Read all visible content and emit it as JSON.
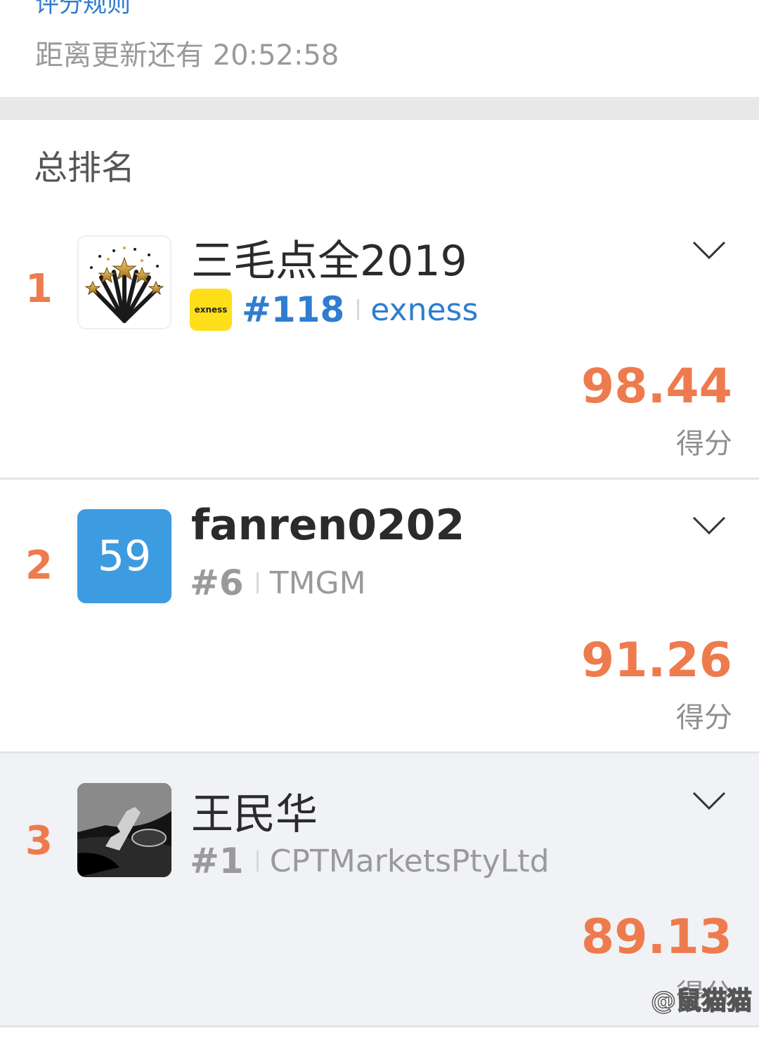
{
  "header": {
    "rules_link": "评分规则",
    "countdown": "距离更新还有 20:52:58"
  },
  "section_title": "总排名",
  "ranking": [
    {
      "rank": "1",
      "name": "三毛点全2019",
      "avatar_type": "stars-icon",
      "broker_logo": "exness",
      "broker_rank": "#118",
      "broker_name": "exness",
      "score": "98.44",
      "score_label": "得分"
    },
    {
      "rank": "2",
      "name": "fanren0202",
      "avatar_type": "number-avatar",
      "avatar_text": "59",
      "broker_rank": "#6",
      "broker_name": "TMGM",
      "score": "91.26",
      "score_label": "得分"
    },
    {
      "rank": "3",
      "name": "王民华",
      "avatar_type": "photo-avatar",
      "broker_rank": "#1",
      "broker_name": "CPTMarketsPtyLtd",
      "score": "89.13",
      "score_label": "得分"
    }
  ],
  "watermark": "@鼠猫猫",
  "colors": {
    "accent_orange": "#ee7b4d",
    "link_blue": "#2e7dd1",
    "avatar_blue": "#3d9be0",
    "exness_yellow": "#ffde1a"
  }
}
